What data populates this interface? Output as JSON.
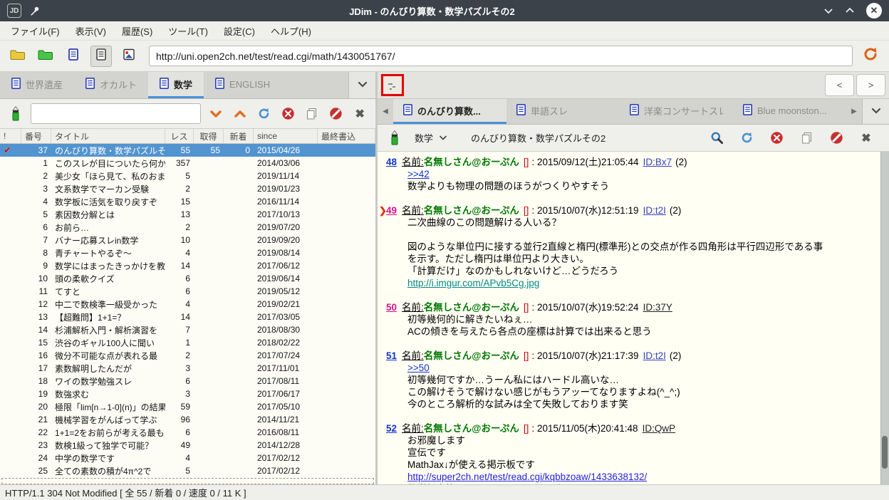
{
  "colors": {
    "titlebar": "#3b4249",
    "selection": "#5294cf",
    "tab_accent": "#4a90d9",
    "name_green": "#007700",
    "mail_red": "#e40000",
    "link_blue": "#2222dd",
    "link_visited": "#008888",
    "anchor_blue": "#1133cc",
    "num_read_magenta": "#dd1188",
    "thumb_border_red": "#e30000"
  },
  "window": {
    "title": "JDim - のんびり算数・数学パズルその2"
  },
  "menubar": {
    "items": [
      "ファイル(F)",
      "表示(V)",
      "履歴(S)",
      "ツール(T)",
      "設定(C)",
      "ヘルプ(H)"
    ]
  },
  "toolbar": {
    "url": "http://uni.open2ch.net/test/read.cgi/math/1430051767/"
  },
  "board_tabs": {
    "tabs": [
      {
        "label": "世界遺産",
        "active": false
      },
      {
        "label": "オカルト",
        "active": false
      },
      {
        "label": "数学",
        "active": true
      },
      {
        "label": "ENGLISH",
        "active": false
      }
    ]
  },
  "search": {
    "value": ""
  },
  "thread_list": {
    "columns": [
      "!",
      "番号",
      "タイトル",
      "レス",
      "取得",
      "新着",
      "since",
      "最終書込"
    ],
    "rows": [
      {
        "mark": true,
        "num": "37",
        "title": "のんびり算数・数学パズルそ",
        "res": "55",
        "got": "55",
        "new": "0",
        "since": "2015/04/26",
        "last": "",
        "selected": true
      },
      {
        "mark": false,
        "num": "1",
        "title": "このスレが目についたら何か",
        "res": "357",
        "got": "",
        "new": "",
        "since": "2014/03/06",
        "last": "",
        "selected": false
      },
      {
        "mark": false,
        "num": "2",
        "title": "美少女「ほら見て、私のおま",
        "res": "5",
        "got": "",
        "new": "",
        "since": "2019/11/14",
        "last": "",
        "selected": false
      },
      {
        "mark": false,
        "num": "3",
        "title": "文系数学でマーカン受験",
        "res": "2",
        "got": "",
        "new": "",
        "since": "2019/01/23",
        "last": "",
        "selected": false
      },
      {
        "mark": false,
        "num": "4",
        "title": "数学板に活気を取り戻すぞ",
        "res": "15",
        "got": "",
        "new": "",
        "since": "2016/11/14",
        "last": "",
        "selected": false
      },
      {
        "mark": false,
        "num": "5",
        "title": "素因数分解とは",
        "res": "13",
        "got": "",
        "new": "",
        "since": "2017/10/13",
        "last": "",
        "selected": false
      },
      {
        "mark": false,
        "num": "6",
        "title": "お前ら…",
        "res": "2",
        "got": "",
        "new": "",
        "since": "2019/07/20",
        "last": "",
        "selected": false
      },
      {
        "mark": false,
        "num": "7",
        "title": "バナー応募スレin数学",
        "res": "10",
        "got": "",
        "new": "",
        "since": "2019/09/20",
        "last": "",
        "selected": false
      },
      {
        "mark": false,
        "num": "8",
        "title": "青チャートやるぞ～",
        "res": "4",
        "got": "",
        "new": "",
        "since": "2019/08/14",
        "last": "",
        "selected": false
      },
      {
        "mark": false,
        "num": "9",
        "title": "数学にはまったきっかけを教",
        "res": "14",
        "got": "",
        "new": "",
        "since": "2017/06/12",
        "last": "",
        "selected": false
      },
      {
        "mark": false,
        "num": "10",
        "title": "頭の柔軟クイズ",
        "res": "6",
        "got": "",
        "new": "",
        "since": "2019/06/14",
        "last": "",
        "selected": false
      },
      {
        "mark": false,
        "num": "11",
        "title": "てすと",
        "res": "6",
        "got": "",
        "new": "",
        "since": "2019/05/12",
        "last": "",
        "selected": false
      },
      {
        "mark": false,
        "num": "12",
        "title": "中二で数検準一級受かった",
        "res": "4",
        "got": "",
        "new": "",
        "since": "2019/02/21",
        "last": "",
        "selected": false
      },
      {
        "mark": false,
        "num": "13",
        "title": "【超難問】1+1=？",
        "res": "14",
        "got": "",
        "new": "",
        "since": "2017/03/05",
        "last": "",
        "selected": false
      },
      {
        "mark": false,
        "num": "14",
        "title": "杉浦解析入門・解析演習を",
        "res": "7",
        "got": "",
        "new": "",
        "since": "2018/08/30",
        "last": "",
        "selected": false
      },
      {
        "mark": false,
        "num": "15",
        "title": "渋谷のギャル100人に聞い",
        "res": "1",
        "got": "",
        "new": "",
        "since": "2018/02/22",
        "last": "",
        "selected": false
      },
      {
        "mark": false,
        "num": "16",
        "title": "微分不可能な点が表れる最",
        "res": "2",
        "got": "",
        "new": "",
        "since": "2017/07/24",
        "last": "",
        "selected": false
      },
      {
        "mark": false,
        "num": "17",
        "title": "素数解明したんだが",
        "res": "3",
        "got": "",
        "new": "",
        "since": "2017/11/01",
        "last": "",
        "selected": false
      },
      {
        "mark": false,
        "num": "18",
        "title": "ワイの数学勉強スレ",
        "res": "6",
        "got": "",
        "new": "",
        "since": "2017/08/11",
        "last": "",
        "selected": false
      },
      {
        "mark": false,
        "num": "19",
        "title": "数強求む",
        "res": "3",
        "got": "",
        "new": "",
        "since": "2017/06/17",
        "last": "",
        "selected": false
      },
      {
        "mark": false,
        "num": "20",
        "title": "極限「lim[n→1-0](n)」の結果",
        "res": "59",
        "got": "",
        "new": "",
        "since": "2017/05/10",
        "last": "",
        "selected": false
      },
      {
        "mark": false,
        "num": "21",
        "title": "機械学習をがんばって学ぶ",
        "res": "96",
        "got": "",
        "new": "",
        "since": "2014/11/21",
        "last": "",
        "selected": false
      },
      {
        "mark": false,
        "num": "22",
        "title": "1+1=2をお前らが考える最も",
        "res": "6",
        "got": "",
        "new": "",
        "since": "2016/08/11",
        "last": "",
        "selected": false
      },
      {
        "mark": false,
        "num": "23",
        "title": "数検1級って独学で可能？",
        "res": "49",
        "got": "",
        "new": "",
        "since": "2014/12/28",
        "last": "",
        "selected": false
      },
      {
        "mark": false,
        "num": "24",
        "title": "中学の数学です",
        "res": "4",
        "got": "",
        "new": "",
        "since": "2017/02/12",
        "last": "",
        "selected": false
      },
      {
        "mark": false,
        "num": "25",
        "title": "全ての素数の積が4π^2で",
        "res": "5",
        "got": "",
        "new": "",
        "since": "2017/02/12",
        "last": "",
        "selected": false
      }
    ]
  },
  "image_strip": {
    "prev_label": "<",
    "next_label": ">"
  },
  "thread_tabs": {
    "tabs": [
      {
        "label": "のんびり算数...",
        "active": true
      },
      {
        "label": "単語スレ",
        "active": false
      },
      {
        "label": "洋楽コンサートスレ",
        "active": false
      },
      {
        "label": "Blue moonston...",
        "active": false
      }
    ]
  },
  "thread_toolbar": {
    "board": "数学",
    "title": "のんびり算数・数学パズルその2"
  },
  "posts": [
    {
      "num": "48",
      "num_style": "blue",
      "marker": false,
      "name_label": "名前:",
      "name": "名無しさん@おーぷん",
      "mail": "[]",
      "date": "2015/09/12(土)21:05:44",
      "id": "ID:Bx7",
      "id_link": true,
      "count": "(2)",
      "lines": [
        {
          "t": ">>42",
          "s": "anchor"
        },
        {
          "t": "数学よりも物理の問題のほうがつくりやすそう",
          "s": "plain"
        }
      ]
    },
    {
      "num": "49",
      "num_style": "magenta",
      "marker": true,
      "name_label": "名前:",
      "name": "名無しさん@おーぷん",
      "mail": "[]",
      "date": "2015/10/07(水)12:51:19",
      "id": "ID:t2I",
      "id_link": true,
      "count": "(2)",
      "lines": [
        {
          "t": "二次曲線のこの問題解ける人いる？",
          "s": "plain"
        },
        {
          "t": "",
          "s": "plain"
        },
        {
          "t": "図のような単位円に接する並行2直線と楕円(標準形)との交点が作る四角形は平行四辺形である事",
          "s": "plain"
        },
        {
          "t": "を示す。ただし楕円は単位円より大きい。",
          "s": "plain"
        },
        {
          "t": "「計算だけ」なのかもしれないけど…どうだろう",
          "s": "plain"
        },
        {
          "t": "http://i.imgur.com/APvb5Cg.jpg",
          "s": "visited"
        }
      ]
    },
    {
      "num": "50",
      "num_style": "magenta",
      "marker": false,
      "name_label": "名前:",
      "name": "名無しさん@おーぷん",
      "mail": "[]",
      "date": "2015/10/07(水)19:52:24",
      "id": "ID:37Y",
      "id_link": false,
      "count": "",
      "lines": [
        {
          "t": "初等幾何的に解きたいねぇ…",
          "s": "plain"
        },
        {
          "t": "ACの傾きを与えたら各点の座標は計算では出来ると思う",
          "s": "plain"
        }
      ]
    },
    {
      "num": "51",
      "num_style": "blue",
      "marker": false,
      "name_label": "名前:",
      "name": "名無しさん@おーぷん",
      "mail": "[]",
      "date": "2015/10/07(水)21:17:39",
      "id": "ID:t2I",
      "id_link": true,
      "count": "(2)",
      "lines": [
        {
          "t": ">>50",
          "s": "anchor"
        },
        {
          "t": "初等幾何ですか…うーん私にはハードル高いな…",
          "s": "plain"
        },
        {
          "t": "この解けそうで解けない感じがもうアッーてなりますよね(^_^;)",
          "s": "plain"
        },
        {
          "t": "今のところ解析的な試みは全て失敗しております笑",
          "s": "plain"
        }
      ]
    },
    {
      "num": "52",
      "num_style": "blue",
      "marker": false,
      "name_label": "名前:",
      "name": "名無しさん@おーぷん",
      "mail": "[]",
      "date": "2015/11/05(木)20:41:48",
      "id": "ID:QwP",
      "id_link": false,
      "count": "",
      "lines": [
        {
          "t": "お邪魔します",
          "s": "plain"
        },
        {
          "t": "宣伝です",
          "s": "plain"
        },
        {
          "t": "MathJax↓が使える掲示板です",
          "s": "plain"
        },
        {
          "t": "http://super2ch.net/test/read.cgi/kqbbzoaw/1433638132/",
          "s": "link"
        },
        {
          "t": "数学板交換しといたんで、よければ",
          "s": "plain"
        }
      ]
    }
  ],
  "statusbar": {
    "text": "HTTP/1.1 304 Not Modified [ 全 55 / 新着 0 / 速度 0 / 11 K ]"
  }
}
